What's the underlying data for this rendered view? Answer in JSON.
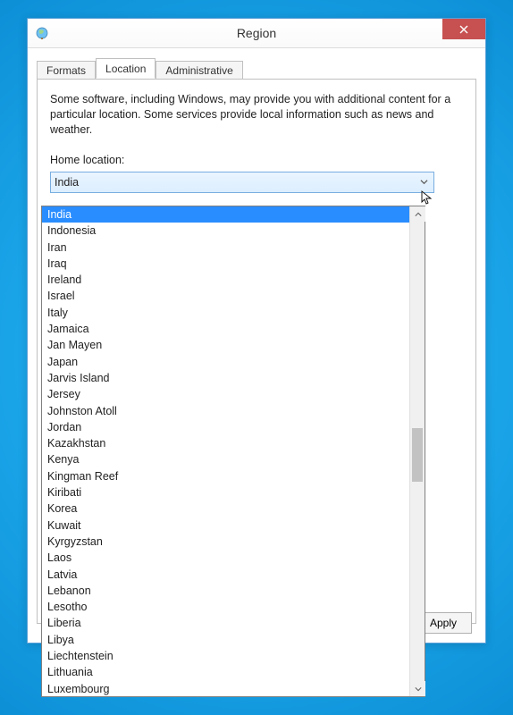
{
  "window": {
    "title": "Region"
  },
  "tabs": {
    "formats": "Formats",
    "location": "Location",
    "administrative": "Administrative"
  },
  "panel": {
    "description": "Some software, including Windows, may provide you with additional content for a particular location. Some services provide local information such as news and weather.",
    "home_location_label": "Home location:",
    "selected_value": "India"
  },
  "dropdown": {
    "items": [
      "India",
      "Indonesia",
      "Iran",
      "Iraq",
      "Ireland",
      "Israel",
      "Italy",
      "Jamaica",
      "Jan Mayen",
      "Japan",
      "Jarvis Island",
      "Jersey",
      "Johnston Atoll",
      "Jordan",
      "Kazakhstan",
      "Kenya",
      "Kingman Reef",
      "Kiribati",
      "Korea",
      "Kuwait",
      "Kyrgyzstan",
      "Laos",
      "Latvia",
      "Lebanon",
      "Lesotho",
      "Liberia",
      "Libya",
      "Liechtenstein",
      "Lithuania",
      "Luxembourg"
    ],
    "selected_index": 0
  },
  "buttons": {
    "apply": "Apply"
  }
}
